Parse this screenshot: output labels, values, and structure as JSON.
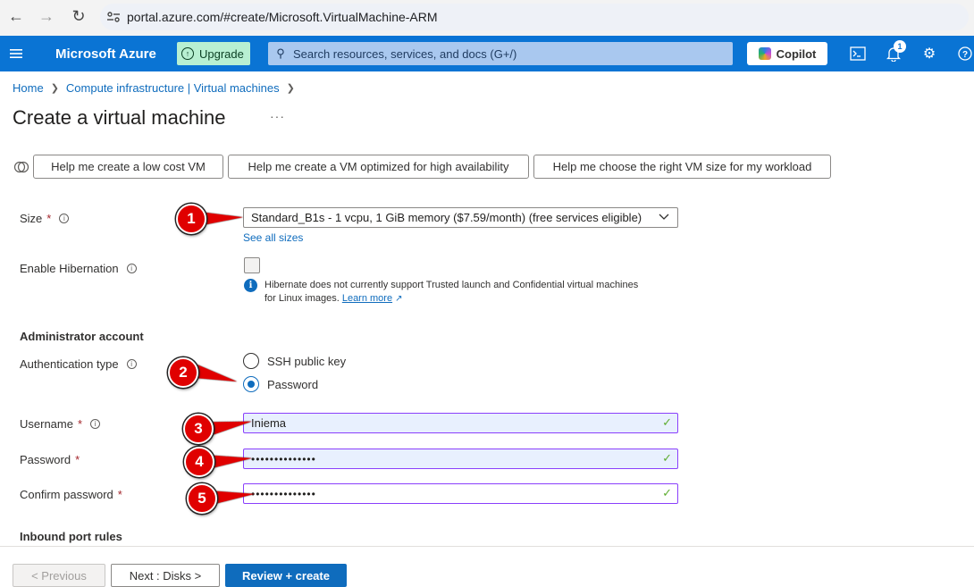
{
  "browser": {
    "url": "portal.azure.com/#create/Microsoft.VirtualMachine-ARM"
  },
  "header": {
    "brand": "Microsoft Azure",
    "upgrade_label": "Upgrade",
    "search_placeholder": "Search resources, services, and docs (G+/)",
    "copilot_label": "Copilot",
    "notification_count": "1"
  },
  "breadcrumb": {
    "items": [
      "Home",
      "Compute infrastructure | Virtual machines"
    ]
  },
  "page": {
    "title": "Create a virtual machine",
    "more": "···"
  },
  "help_buttons": [
    "Help me create a low cost VM",
    "Help me create a VM optimized for high availability",
    "Help me choose the right VM size for my workload"
  ],
  "form": {
    "size": {
      "label": "Size",
      "required": "*",
      "value": "Standard_B1s - 1 vcpu, 1 GiB memory ($7.59/month)  (free services eligible)",
      "see_all": "See all sizes"
    },
    "hibernation": {
      "label": "Enable Hibernation",
      "checked": false,
      "note": "Hibernate does not currently support Trusted launch and Confidential virtual machines for Linux images.",
      "learn_more": "Learn more"
    },
    "admin_section": "Administrator account",
    "auth_type": {
      "label": "Authentication type",
      "options": [
        "SSH public key",
        "Password"
      ],
      "selected": "Password"
    },
    "username": {
      "label": "Username",
      "required": "*",
      "value": "Iniema"
    },
    "password": {
      "label": "Password",
      "required": "*",
      "value": "••••••••••••••"
    },
    "confirm_password": {
      "label": "Confirm password",
      "required": "*",
      "value": "••••••••••••••"
    },
    "inbound_section": "Inbound port rules"
  },
  "markers": [
    "1",
    "2",
    "3",
    "4",
    "5"
  ],
  "footer": {
    "previous": "< Previous",
    "next": "Next : Disks >",
    "review": "Review + create"
  },
  "colors": {
    "azure_blue": "#0a74d4",
    "link": "#0f6cbd",
    "marker_red": "#e00000",
    "valid_green": "#5fae32",
    "field_border": "#8a3ffc"
  }
}
